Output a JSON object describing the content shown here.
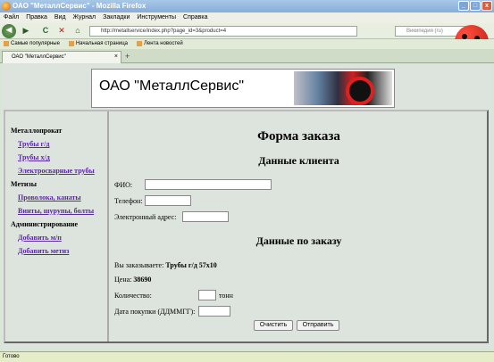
{
  "window": {
    "title": "ОАО \"МеталлСервис\" - Mozilla Firefox",
    "btn_min": "_",
    "btn_max": "□",
    "btn_close": "x"
  },
  "menu": [
    "Файл",
    "Правка",
    "Вид",
    "Журнал",
    "Закладки",
    "Инструменты",
    "Справка"
  ],
  "nav": {
    "back": "◀",
    "forward": "▶",
    "reload": "C",
    "stop": "✕",
    "home": "⌂",
    "url": "http://metallservice/index.php?page_id=3&product=4",
    "search_placeholder": "Википедия (ru)"
  },
  "bookmarks": [
    "Самые популярные",
    "Начальная страница",
    "Лента новостей"
  ],
  "tab": {
    "title": "ОАО \"МеталлСервис\"",
    "close": "×",
    "new_tab": "+"
  },
  "banner": {
    "title": "ОАО \"МеталлСервис\""
  },
  "sidebar": {
    "sections": [
      {
        "title": "Металлопрокат",
        "links": [
          "Трубы г/д",
          "Трубы х/д",
          "Электросварные трубы"
        ]
      },
      {
        "title": "Метизы",
        "links": [
          "Проволока, канаты",
          "Винты, шурупы, болты"
        ]
      },
      {
        "title": "Администрирование",
        "links": [
          "Добавить м/п",
          "Добавить метиз"
        ]
      }
    ]
  },
  "form": {
    "title": "Форма заказа",
    "client_heading": "Данные клиента",
    "fio_label": "ФИО:",
    "phone_label": "Телефон:",
    "email_label": "Электронный адрес:",
    "order_heading": "Данные по заказу",
    "ordering_prefix": "Вы заказываете:",
    "ordering_value": "Трубы г/д 57x10",
    "price_prefix": "Цена:",
    "price_value": "38690",
    "qty_label": "Количество:",
    "qty_unit": "тонн",
    "date_label": "Дата покупки (ДДММГГ):",
    "clear_button": "Очистить",
    "submit_button": "Отправить"
  },
  "status": "Готово"
}
